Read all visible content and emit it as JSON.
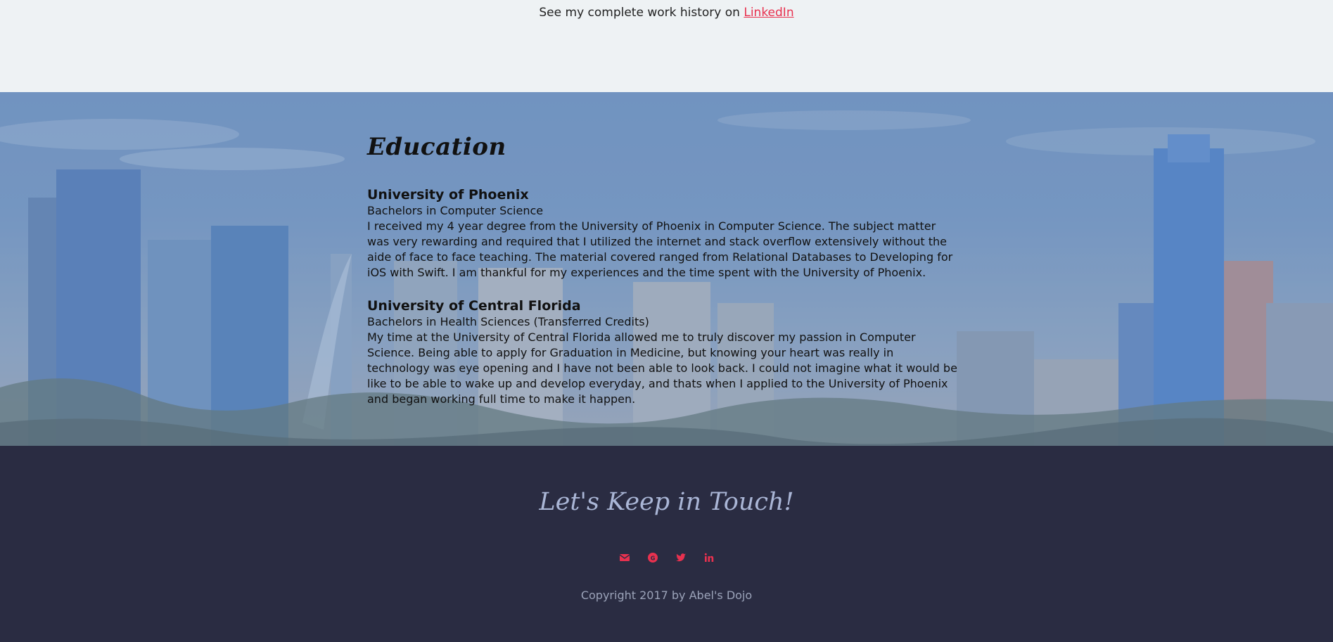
{
  "work_history": {
    "text": "See my complete work history on ",
    "link_label": "LinkedIn"
  },
  "education": {
    "heading": "Education",
    "schools": [
      {
        "name": "University of Phoenix",
        "degree": "Bachelors in Computer Science",
        "description": "I received my 4 year degree from the University of Phoenix in Computer Science. The subject matter was very rewarding and required that I utilized the internet and stack overflow extensively without the aide of face to face teaching. The material covered ranged from Relational Databases to Developing for iOS with Swift. I am thankful for my experiences and the time spent with the University of Phoenix."
      },
      {
        "name": "University of Central Florida",
        "degree": "Bachelors in Health Sciences (Transferred Credits)",
        "description": "My time at the University of Central Florida allowed me to truly discover my passion in Computer Science. Being able to apply for Graduation in Medicine, but knowing your heart was really in technology was eye opening and I have not been able to look back. I could not imagine what it would be like to be able to wake up and develop everyday, and thats when I applied to the University of Phoenix and began working full time to make it happen."
      }
    ]
  },
  "footer": {
    "heading": "Let's Keep in Touch!",
    "social_icons": [
      "envelope-icon",
      "google-plus-icon",
      "twitter-icon",
      "linkedin-icon"
    ],
    "copyright": "Copyright 2017 by Abel's Dojo"
  },
  "colors": {
    "accent": "#e8314f",
    "footer_bg": "#2a2c42",
    "top_bg": "#eef2f4"
  }
}
